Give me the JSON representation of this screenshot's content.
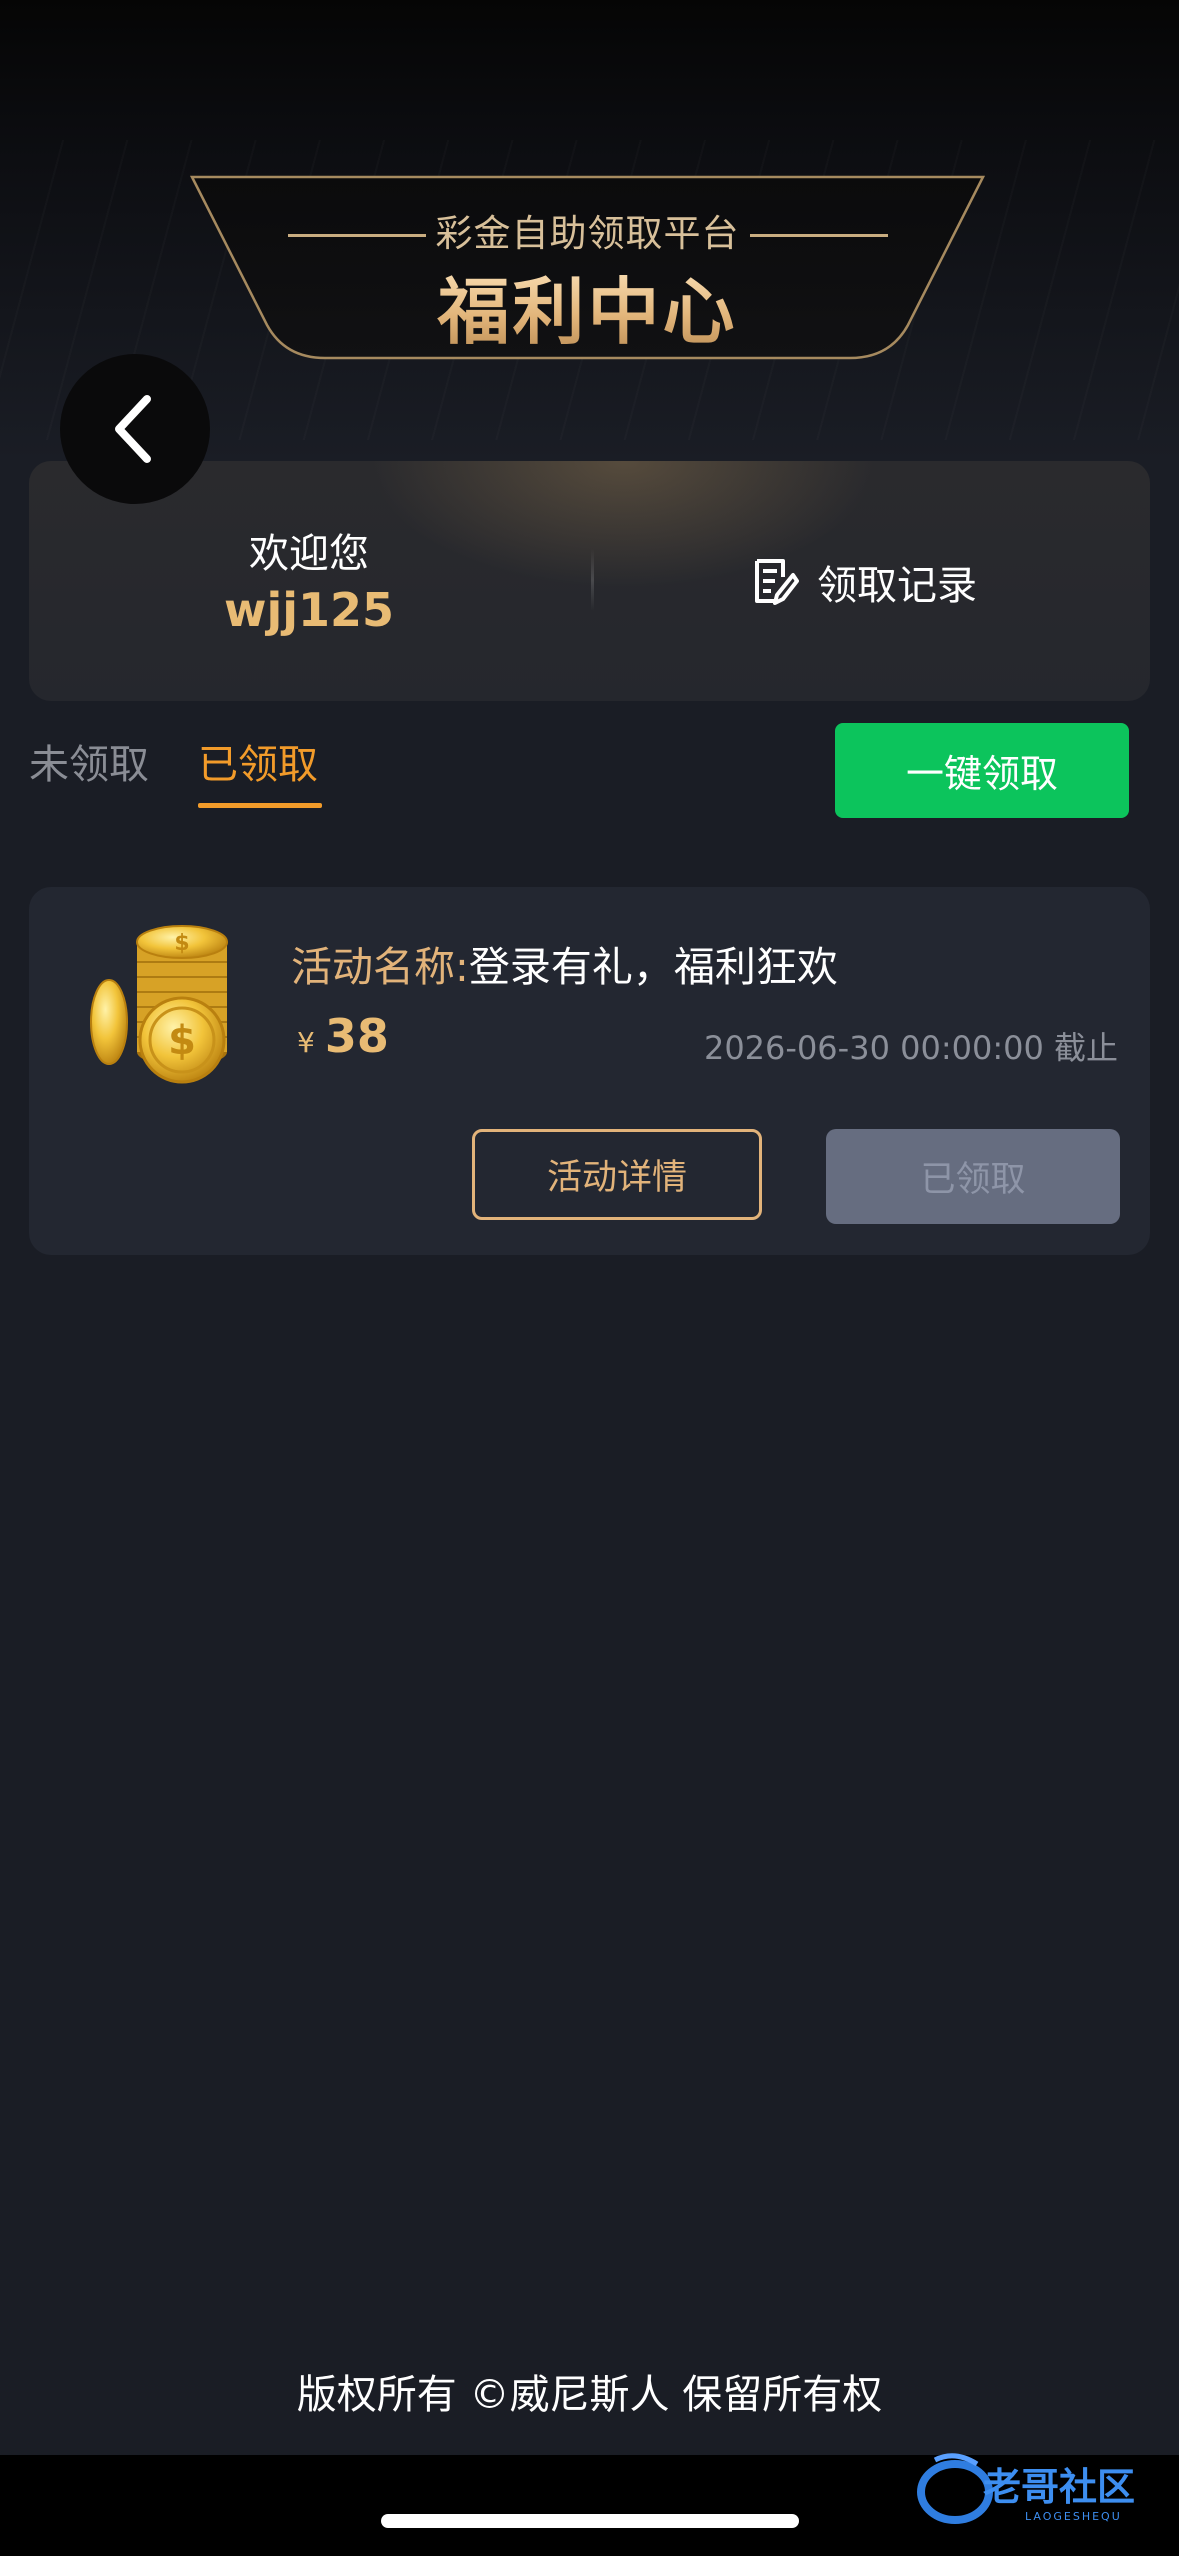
{
  "banner": {
    "subtitle": "彩金自助领取平台",
    "title": "福利中心"
  },
  "welcome": {
    "label": "欢迎您",
    "username": "wjj125",
    "record_link": "领取记录"
  },
  "tabs": [
    {
      "label": "未领取",
      "active": false
    },
    {
      "label": "已领取",
      "active": true
    }
  ],
  "claim_all_button": "一键领取",
  "activity": {
    "name_label": "活动名称:",
    "name": "登录有礼，福利狂欢",
    "currency": "¥",
    "amount": "38",
    "deadline": "2026-06-30 00:00:00 截止",
    "detail_button": "活动详情",
    "status_button": "已领取"
  },
  "footer": "版权所有 ©威尼斯人 保留所有权",
  "watermark": {
    "text": "老哥社区",
    "subtext": "LAOGESHEQU"
  },
  "colors": {
    "background": "#1a1d25",
    "gold": "#e2b37a",
    "orange_accent": "#f29b2a",
    "green_button": "#0cc45c",
    "disabled_button": "#666d80"
  },
  "icons": [
    "back-chevron-icon",
    "record-document-icon",
    "coins-stack-icon"
  ]
}
